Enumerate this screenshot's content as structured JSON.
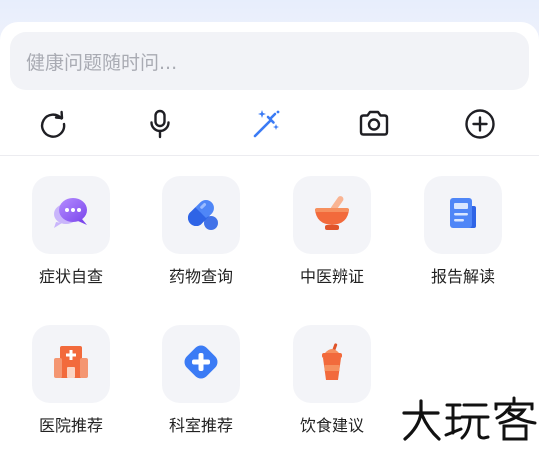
{
  "search": {
    "placeholder": "健康问题随时问..."
  },
  "toolbar": {
    "items": [
      {
        "name": "refresh-icon"
      },
      {
        "name": "microphone-icon"
      },
      {
        "name": "magic-wand-icon",
        "color": "#3b7bf5"
      },
      {
        "name": "camera-icon"
      },
      {
        "name": "add-circle-icon"
      }
    ]
  },
  "services": [
    {
      "label": "症状自查",
      "icon": "chat-bubbles-icon"
    },
    {
      "label": "药物查询",
      "icon": "capsule-icon"
    },
    {
      "label": "中医辨证",
      "icon": "mortar-bowl-icon"
    },
    {
      "label": "报告解读",
      "icon": "report-document-icon"
    },
    {
      "label": "医院推荐",
      "icon": "hospital-icon"
    },
    {
      "label": "科室推荐",
      "icon": "medical-cross-icon"
    },
    {
      "label": "饮食建议",
      "icon": "drink-cup-icon"
    }
  ],
  "watermark": {
    "text": "大玩客"
  },
  "colors": {
    "accent_blue": "#3b7bf5",
    "purple": "#8c5cf0",
    "orange": "#f26a3c",
    "icon_dark": "#1f1f24"
  }
}
